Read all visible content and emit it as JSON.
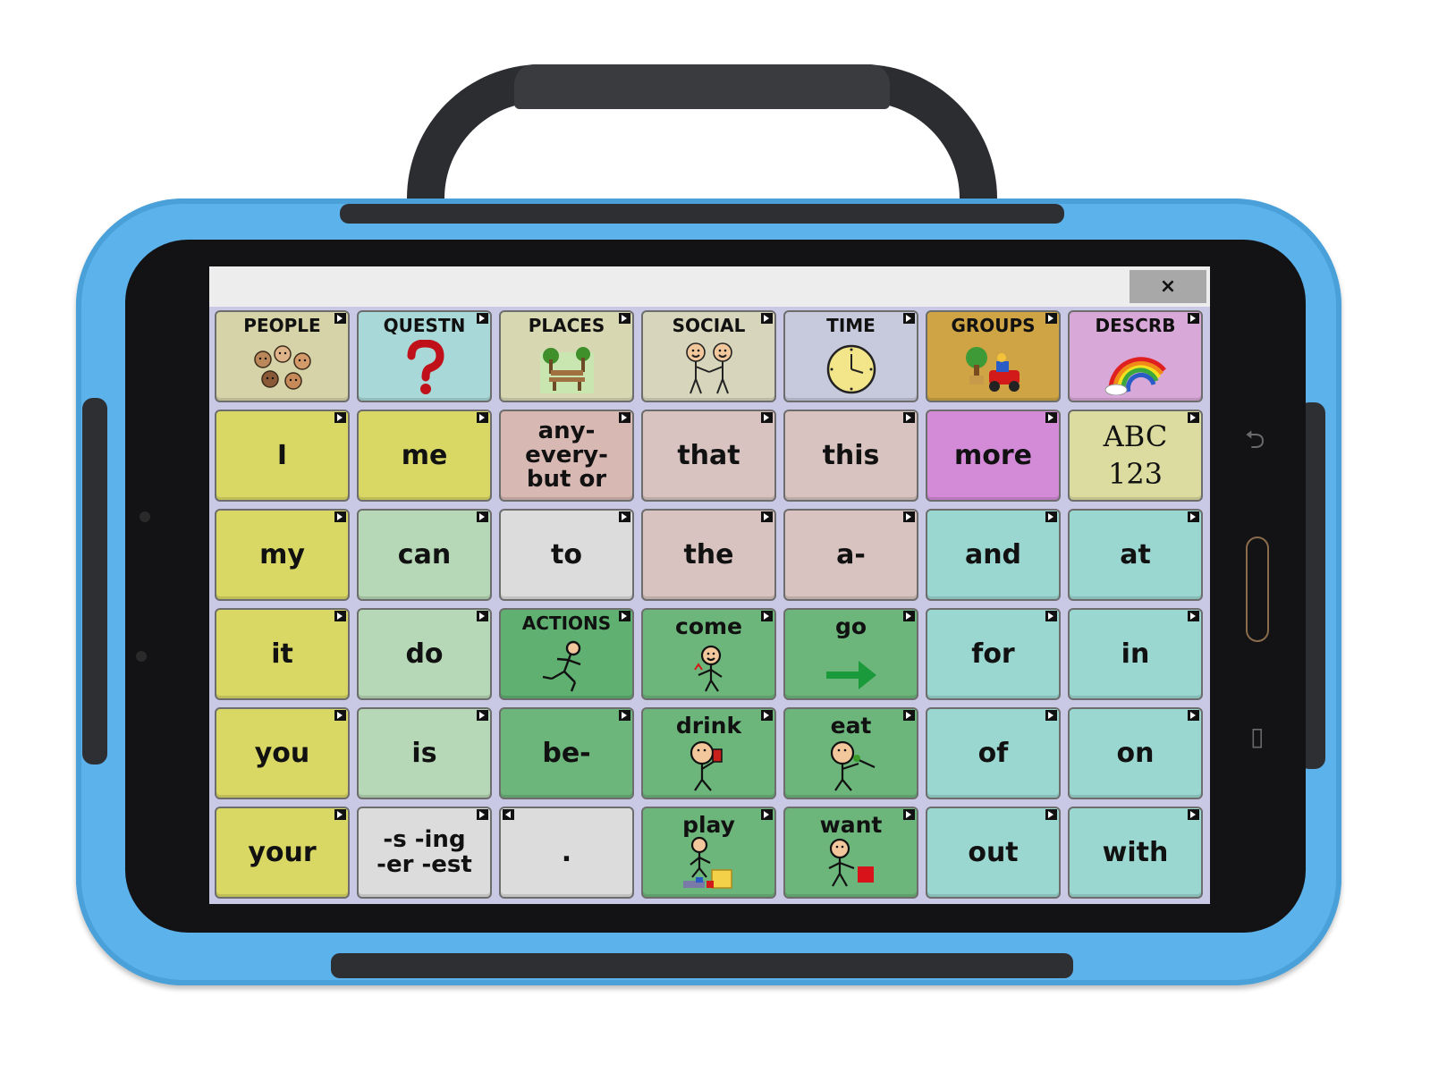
{
  "window": {
    "close_label": "×"
  },
  "colors": {
    "case": "#5cb2ea",
    "yellow": "#d9d864",
    "green_light": "#b7d8b6",
    "green_dark": "#6cb57b",
    "pink": "#d8b8b3",
    "teal": "#9bd7d1",
    "grey": "#dcdcdc",
    "purple": "#d38ad7",
    "gold": "#cfa444"
  },
  "rows": [
    [
      {
        "label": "PEOPLE",
        "kind": "cat",
        "bg": "#d6d3a8",
        "icon": "people-icon"
      },
      {
        "label": "QUESTN",
        "kind": "cat",
        "bg": "#a8d8d8",
        "icon": "question-mark-icon"
      },
      {
        "label": "PLACES",
        "kind": "cat",
        "bg": "#d7d8b2",
        "icon": "park-bench-icon"
      },
      {
        "label": "SOCIAL",
        "kind": "cat",
        "bg": "#d7d6bd",
        "icon": "handshake-icon"
      },
      {
        "label": "TIME",
        "kind": "cat",
        "bg": "#c7c9dc",
        "icon": "clock-icon"
      },
      {
        "label": "GROUPS",
        "kind": "cat",
        "bg": "#cfa444",
        "icon": "toys-icon"
      },
      {
        "label": "DESCRB",
        "kind": "cat",
        "bg": "#d8a8d8",
        "icon": "rainbow-icon"
      }
    ],
    [
      {
        "label": "I",
        "bg": "#d9d864"
      },
      {
        "label": "me",
        "bg": "#d9d864"
      },
      {
        "label": "any- every-\nbut  or",
        "bg": "#d8b8b3",
        "small": true
      },
      {
        "label": "that",
        "bg": "#d8c3c0"
      },
      {
        "label": "this",
        "bg": "#d8c3c0"
      },
      {
        "label": "more",
        "bg": "#d38ad7"
      },
      {
        "label": "ABC\n123",
        "bg": "#dcdca0",
        "serif": true
      }
    ],
    [
      {
        "label": "my",
        "bg": "#d9d864"
      },
      {
        "label": "can",
        "bg": "#b7d8b6"
      },
      {
        "label": "to",
        "bg": "#dcdcdc"
      },
      {
        "label": "the",
        "bg": "#d8c3c0"
      },
      {
        "label": "a-",
        "bg": "#d8c3c0"
      },
      {
        "label": "and",
        "bg": "#9bd7d1"
      },
      {
        "label": "at",
        "bg": "#9bd7d1"
      }
    ],
    [
      {
        "label": "it",
        "bg": "#d9d864"
      },
      {
        "label": "do",
        "bg": "#b7d8b6"
      },
      {
        "label": "ACTIONS",
        "kind": "cat",
        "bg": "#5fb071",
        "icon": "running-person-icon"
      },
      {
        "label": "come",
        "kind": "toplbl",
        "bg": "#6cb57b",
        "icon": "come-person-icon"
      },
      {
        "label": "go",
        "kind": "toplbl",
        "bg": "#6cb57b",
        "icon": "right-arrow-icon"
      },
      {
        "label": "for",
        "bg": "#9bd7d1"
      },
      {
        "label": "in",
        "bg": "#9bd7d1"
      }
    ],
    [
      {
        "label": "you",
        "bg": "#d9d864"
      },
      {
        "label": "is",
        "bg": "#b7d8b6"
      },
      {
        "label": "be-",
        "bg": "#6cb57b"
      },
      {
        "label": "drink",
        "kind": "toplbl",
        "bg": "#6cb57b",
        "icon": "drink-person-icon"
      },
      {
        "label": "eat",
        "kind": "toplbl",
        "bg": "#6cb57b",
        "icon": "eat-person-icon"
      },
      {
        "label": "of",
        "bg": "#9bd7d1"
      },
      {
        "label": "on",
        "bg": "#9bd7d1"
      }
    ],
    [
      {
        "label": "your",
        "bg": "#d9d864"
      },
      {
        "label": "-s -ing\n-er -est",
        "bg": "#dcdcdc",
        "small": true
      },
      {
        "label": ".",
        "bg": "#dcdcdc",
        "leftcorner": true
      },
      {
        "label": "play",
        "kind": "toplbl",
        "bg": "#6cb57b",
        "icon": "play-person-icon"
      },
      {
        "label": "want",
        "kind": "toplbl",
        "bg": "#6cb57b",
        "icon": "want-person-icon"
      },
      {
        "label": "out",
        "bg": "#9bd7d1"
      },
      {
        "label": "with",
        "bg": "#9bd7d1"
      }
    ]
  ]
}
